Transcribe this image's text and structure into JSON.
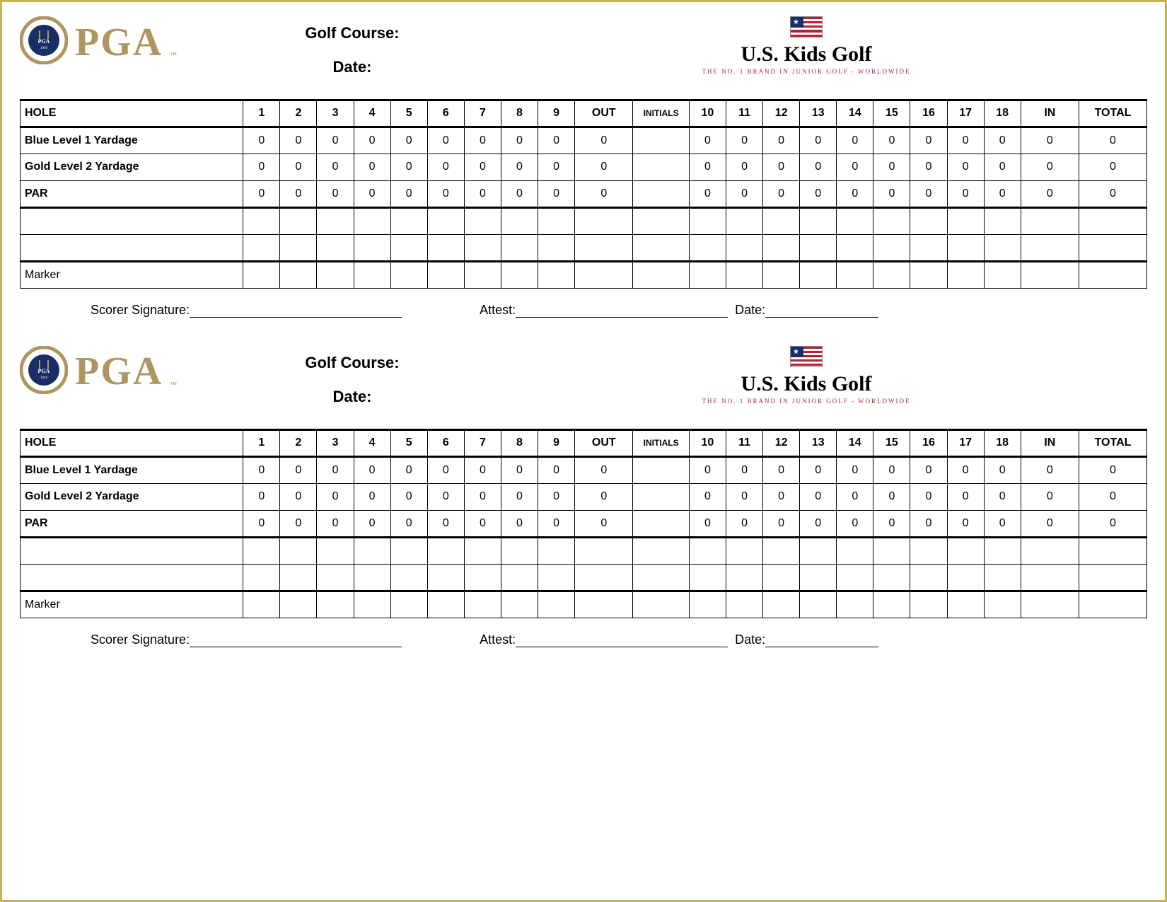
{
  "labels": {
    "golf_course": "Golf Course:",
    "date": "Date:",
    "pga": "PGA",
    "uskids_title": "U.S. Kids Golf",
    "uskids_sub": "THE NO. 1 BRAND IN JUNIOR GOLF - WORLDWIDE",
    "scorer_signature": "Scorer Signature:",
    "attest": "Attest:",
    "sig_date": "Date:"
  },
  "columns": {
    "hole": "HOLE",
    "holes_front": [
      "1",
      "2",
      "3",
      "4",
      "5",
      "6",
      "7",
      "8",
      "9"
    ],
    "out": "OUT",
    "initials": "INITIALS",
    "holes_back": [
      "10",
      "11",
      "12",
      "13",
      "14",
      "15",
      "16",
      "17",
      "18"
    ],
    "in": "IN",
    "total": "TOTAL"
  },
  "rows": {
    "blue": {
      "label": "Blue Level 1 Yardage",
      "front": [
        "0",
        "0",
        "0",
        "0",
        "0",
        "0",
        "0",
        "0",
        "0"
      ],
      "out": "0",
      "back": [
        "0",
        "0",
        "0",
        "0",
        "0",
        "0",
        "0",
        "0",
        "0"
      ],
      "in": "0",
      "total": "0"
    },
    "gold": {
      "label": "Gold Level 2 Yardage",
      "front": [
        "0",
        "0",
        "0",
        "0",
        "0",
        "0",
        "0",
        "0",
        "0"
      ],
      "out": "0",
      "back": [
        "0",
        "0",
        "0",
        "0",
        "0",
        "0",
        "0",
        "0",
        "0"
      ],
      "in": "0",
      "total": "0"
    },
    "par": {
      "label": "PAR",
      "front": [
        "0",
        "0",
        "0",
        "0",
        "0",
        "0",
        "0",
        "0",
        "0"
      ],
      "out": "0",
      "back": [
        "0",
        "0",
        "0",
        "0",
        "0",
        "0",
        "0",
        "0",
        "0"
      ],
      "in": "0",
      "total": "0"
    },
    "marker": {
      "label": "Marker"
    }
  }
}
